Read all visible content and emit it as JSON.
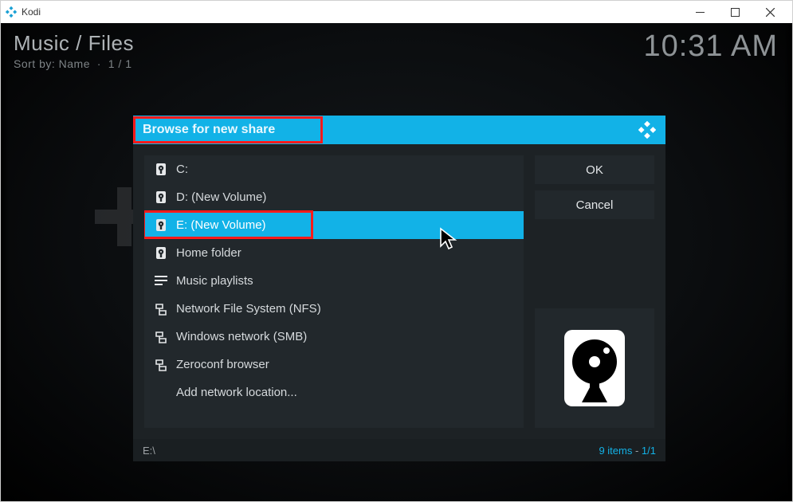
{
  "titlebar": {
    "app_name": "Kodi"
  },
  "header": {
    "breadcrumb": "Music / Files",
    "subline_prefix": "Sort by:",
    "subline_sort": "Name",
    "subline_sep": "·",
    "subline_page": "1 / 1",
    "clock": "10:31 AM"
  },
  "dialog": {
    "title": "Browse for new share",
    "items": [
      {
        "icon": "drive",
        "label": "C:"
      },
      {
        "icon": "drive",
        "label": "D: (New Volume)"
      },
      {
        "icon": "drive",
        "label": "E: (New Volume)",
        "selected": true,
        "highlighted": true
      },
      {
        "icon": "drive",
        "label": "Home folder"
      },
      {
        "icon": "playlist",
        "label": "Music playlists"
      },
      {
        "icon": "network",
        "label": "Network File System (NFS)"
      },
      {
        "icon": "network",
        "label": "Windows network (SMB)"
      },
      {
        "icon": "network",
        "label": "Zeroconf browser"
      },
      {
        "icon": "none",
        "label": "Add network location..."
      }
    ],
    "ok_label": "OK",
    "cancel_label": "Cancel",
    "footer_path": "E:\\",
    "footer_count_items": "9 items",
    "footer_count_dash": " - ",
    "footer_count_page": "1/1"
  }
}
